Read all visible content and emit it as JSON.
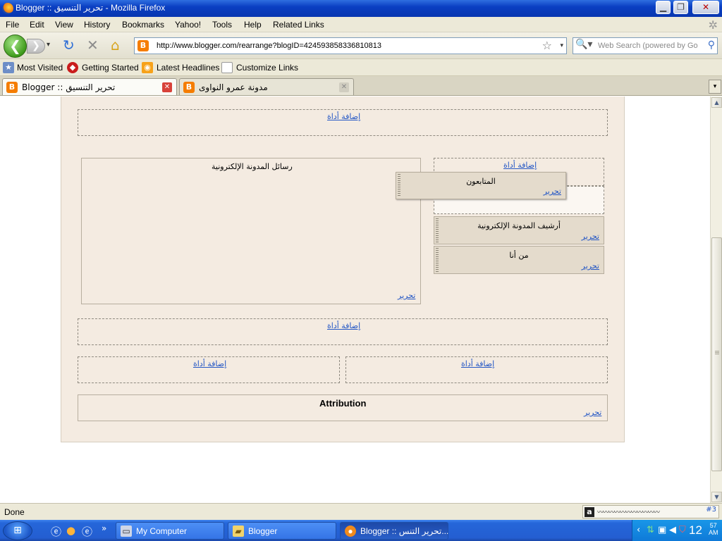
{
  "window": {
    "title": "Blogger :: تحرير التنسيق - Mozilla Firefox",
    "minimize": "▁",
    "maximize": "❐",
    "close": "✕"
  },
  "menu": {
    "items": [
      "File",
      "Edit",
      "View",
      "History",
      "Bookmarks",
      "Yahoo!",
      "Tools",
      "Help",
      "Related Links"
    ]
  },
  "nav": {
    "back": "❮",
    "forward": "❯",
    "dropdown": "▾",
    "reload": "↻",
    "stop": "✕",
    "home": "⌂",
    "url": "http://www.blogger.com/rearrange?blogID=4245938583368108​13",
    "favicon": "B",
    "star": "☆",
    "url_dropdown": "▾",
    "search_placeholder": "Web Search (powered by Go",
    "search_engine_icon": "magnifier-icon",
    "search_go": "⚲"
  },
  "bookmarks": {
    "items": [
      {
        "label": "Most Visited",
        "icon": "star-folder-icon"
      },
      {
        "label": "Getting Started",
        "icon": "red-hat-icon"
      },
      {
        "label": "Latest Headlines",
        "icon": "rss-icon"
      },
      {
        "label": "Customize Links",
        "icon": "page-icon"
      }
    ]
  },
  "tabs": [
    {
      "label": "Blogger :: تحرير التنسيق",
      "active": true
    },
    {
      "label": "مدونة عمرو النواوى",
      "active": false
    }
  ],
  "layout": {
    "add_gadget": "إضافة أداة",
    "edit": "تحرير",
    "blog_posts_title": "رسائل المدونة الإلكترونية",
    "followers_title": "المتابعون",
    "archive_title": "أرشيف المدونة الإلكترونية",
    "about_title": "من أنا",
    "attribution_title": "Attribution"
  },
  "status": {
    "text": "Done",
    "panel_icon": "a",
    "panel_hash": "#3"
  },
  "taskbar": {
    "buttons": [
      {
        "label": "My Computer",
        "icon": "computer-icon"
      },
      {
        "label": "Blogger",
        "icon": "folder-icon"
      },
      {
        "label": "Blogger :: تحرير التنس...",
        "icon": "firefox-icon"
      }
    ],
    "time": "12",
    "time_min": "57",
    "ampm": "AM",
    "more": "»"
  },
  "colors": {
    "link": "#2356c5",
    "layout_bg": "#f4ebe1",
    "widget_bg": "#e4dbcc"
  }
}
